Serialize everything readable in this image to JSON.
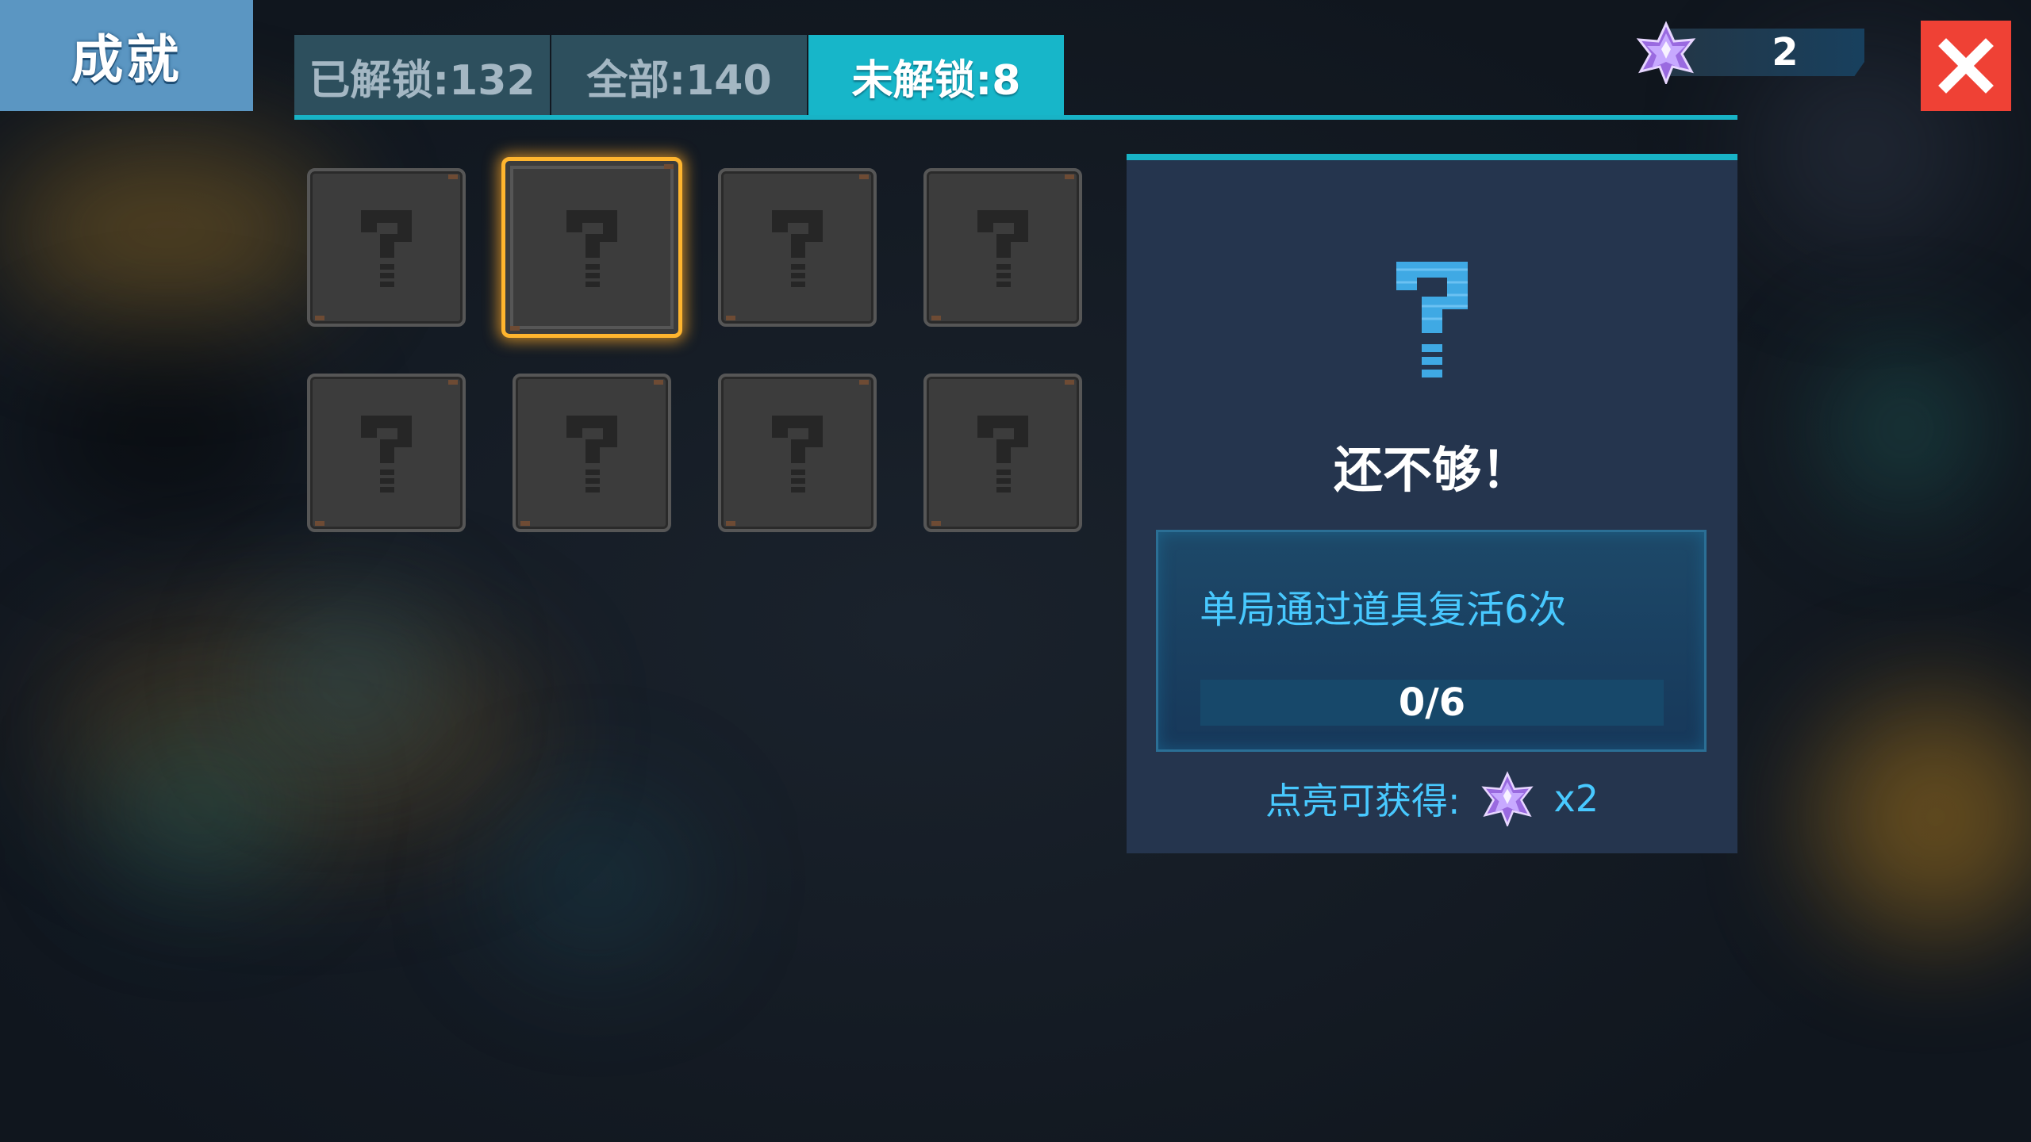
{
  "header": {
    "title": "成就",
    "currency": {
      "icon": "star-crystal-icon",
      "value": "2"
    },
    "close_icon": "close-icon"
  },
  "tabs": [
    {
      "label": "已解锁:132",
      "active": false
    },
    {
      "label": "全部:140",
      "active": false
    },
    {
      "label": "未解锁:8",
      "active": true
    }
  ],
  "grid": {
    "cards": [
      {
        "icon": "question-mark-icon",
        "selected": false
      },
      {
        "icon": "question-mark-icon",
        "selected": true
      },
      {
        "icon": "question-mark-icon",
        "selected": false
      },
      {
        "icon": "question-mark-icon",
        "selected": false
      },
      {
        "icon": "question-mark-icon",
        "selected": false
      },
      {
        "icon": "question-mark-icon",
        "selected": false
      },
      {
        "icon": "question-mark-icon",
        "selected": false
      },
      {
        "icon": "question-mark-icon",
        "selected": false
      }
    ]
  },
  "detail": {
    "icon": "question-mark-icon",
    "title": "还不够！",
    "requirement": "单局通过道具复活6次",
    "progress_text": "0/6",
    "progress_fraction": 0,
    "reward_label": "点亮可获得:",
    "reward_icon": "star-crystal-icon",
    "reward_count": "x2"
  },
  "colors": {
    "accent": "#18b3c6",
    "close": "#ef4135",
    "selected_border": "#ffb52e",
    "text_blue": "#48c9ff"
  }
}
